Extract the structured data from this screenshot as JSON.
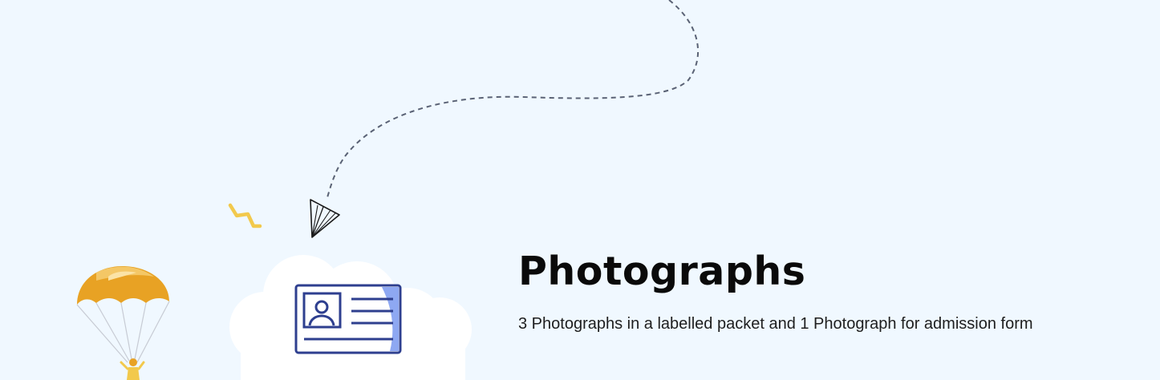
{
  "section": {
    "title": "Photographs",
    "description": "3 Photographs in a labelled packet and 1 Photograph for admission form"
  },
  "icons": {
    "paper_plane": "paper-plane-icon",
    "id_card": "id-card-icon",
    "parachute": "parachute-icon",
    "sparkle": "zigzag-sparkle-icon",
    "cloud": "cloud-icon"
  },
  "colors": {
    "background": "#f0f8ff",
    "card_stroke": "#2e3f8f",
    "card_accent": "#8ea8f2",
    "parachute": "#e8a224",
    "sparkle": "#f2c94c",
    "dash_line": "#5a6275"
  }
}
